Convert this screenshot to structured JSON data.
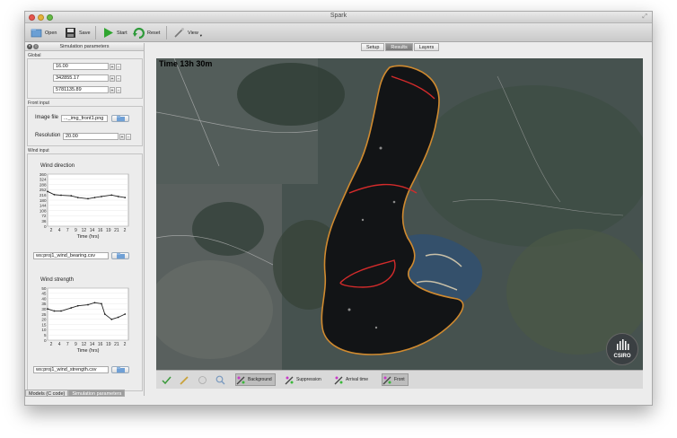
{
  "window": {
    "title": "Spark"
  },
  "toolbar": {
    "open": "Open",
    "save": "Save",
    "start": "Start",
    "reset": "Reset",
    "view": "View"
  },
  "left_panel": {
    "title": "Simulation parameters",
    "global": {
      "label": "Global",
      "values": [
        "16.00",
        "342855.17",
        "5781135.89"
      ]
    },
    "front_input": {
      "label": "Front input",
      "image_label": "Image file",
      "image_value": "..._img_front1.png",
      "resolution_label": "Resolution",
      "resolution_value": "20.00"
    },
    "wind_input": {
      "label": "Wind input",
      "direction_title": "Wind direction",
      "direction_file": "ws:proj1_wind_bearing.csv",
      "strength_title": "Wind strength",
      "strength_file": "ws:proj1_wind_strength.csv"
    }
  },
  "bottom_tabs": [
    "Models (C code)",
    "Simulation parameters"
  ],
  "top_tabs": [
    "Setup",
    "Results",
    "Layers"
  ],
  "map": {
    "time_label": "Time 13h 30m",
    "logo_text": "CSIRO"
  },
  "layers": {
    "background": "Background",
    "suppression": "Suppression",
    "arrival_time": "Arrival time",
    "front": "Front"
  },
  "chart_data": [
    {
      "type": "line",
      "title": "Wind direction",
      "xlabel": "Time (hrs)",
      "ylabel": "",
      "x_ticks": [
        "2",
        "4",
        "7",
        "9",
        "12",
        "14",
        "16",
        "19",
        "21",
        "2"
      ],
      "y_ticks": [
        "360",
        "324",
        "288",
        "252",
        "216",
        "180",
        "144",
        "108",
        "72",
        "36",
        "0"
      ],
      "ylim": [
        0,
        360
      ],
      "series": [
        {
          "x": [
            0,
            2,
            4,
            7,
            9,
            12,
            14,
            16,
            19,
            21,
            23
          ],
          "values": [
            240,
            218,
            214,
            210,
            198,
            190,
            198,
            205,
            215,
            205,
            198
          ]
        }
      ]
    },
    {
      "type": "line",
      "title": "Wind strength",
      "xlabel": "Time (hrs)",
      "ylabel": "",
      "x_ticks": [
        "2",
        "4",
        "7",
        "9",
        "12",
        "14",
        "16",
        "19",
        "21",
        "2"
      ],
      "y_ticks": [
        "50",
        "45",
        "40",
        "35",
        "30",
        "25",
        "20",
        "15",
        "10",
        "5",
        "0"
      ],
      "ylim": [
        0,
        50
      ],
      "series": [
        {
          "x": [
            0,
            2,
            4,
            7,
            9,
            12,
            14,
            16,
            17,
            19,
            21,
            23
          ],
          "values": [
            30,
            28,
            28,
            31,
            33,
            34,
            36,
            35,
            25,
            20,
            22,
            25
          ]
        }
      ]
    }
  ]
}
